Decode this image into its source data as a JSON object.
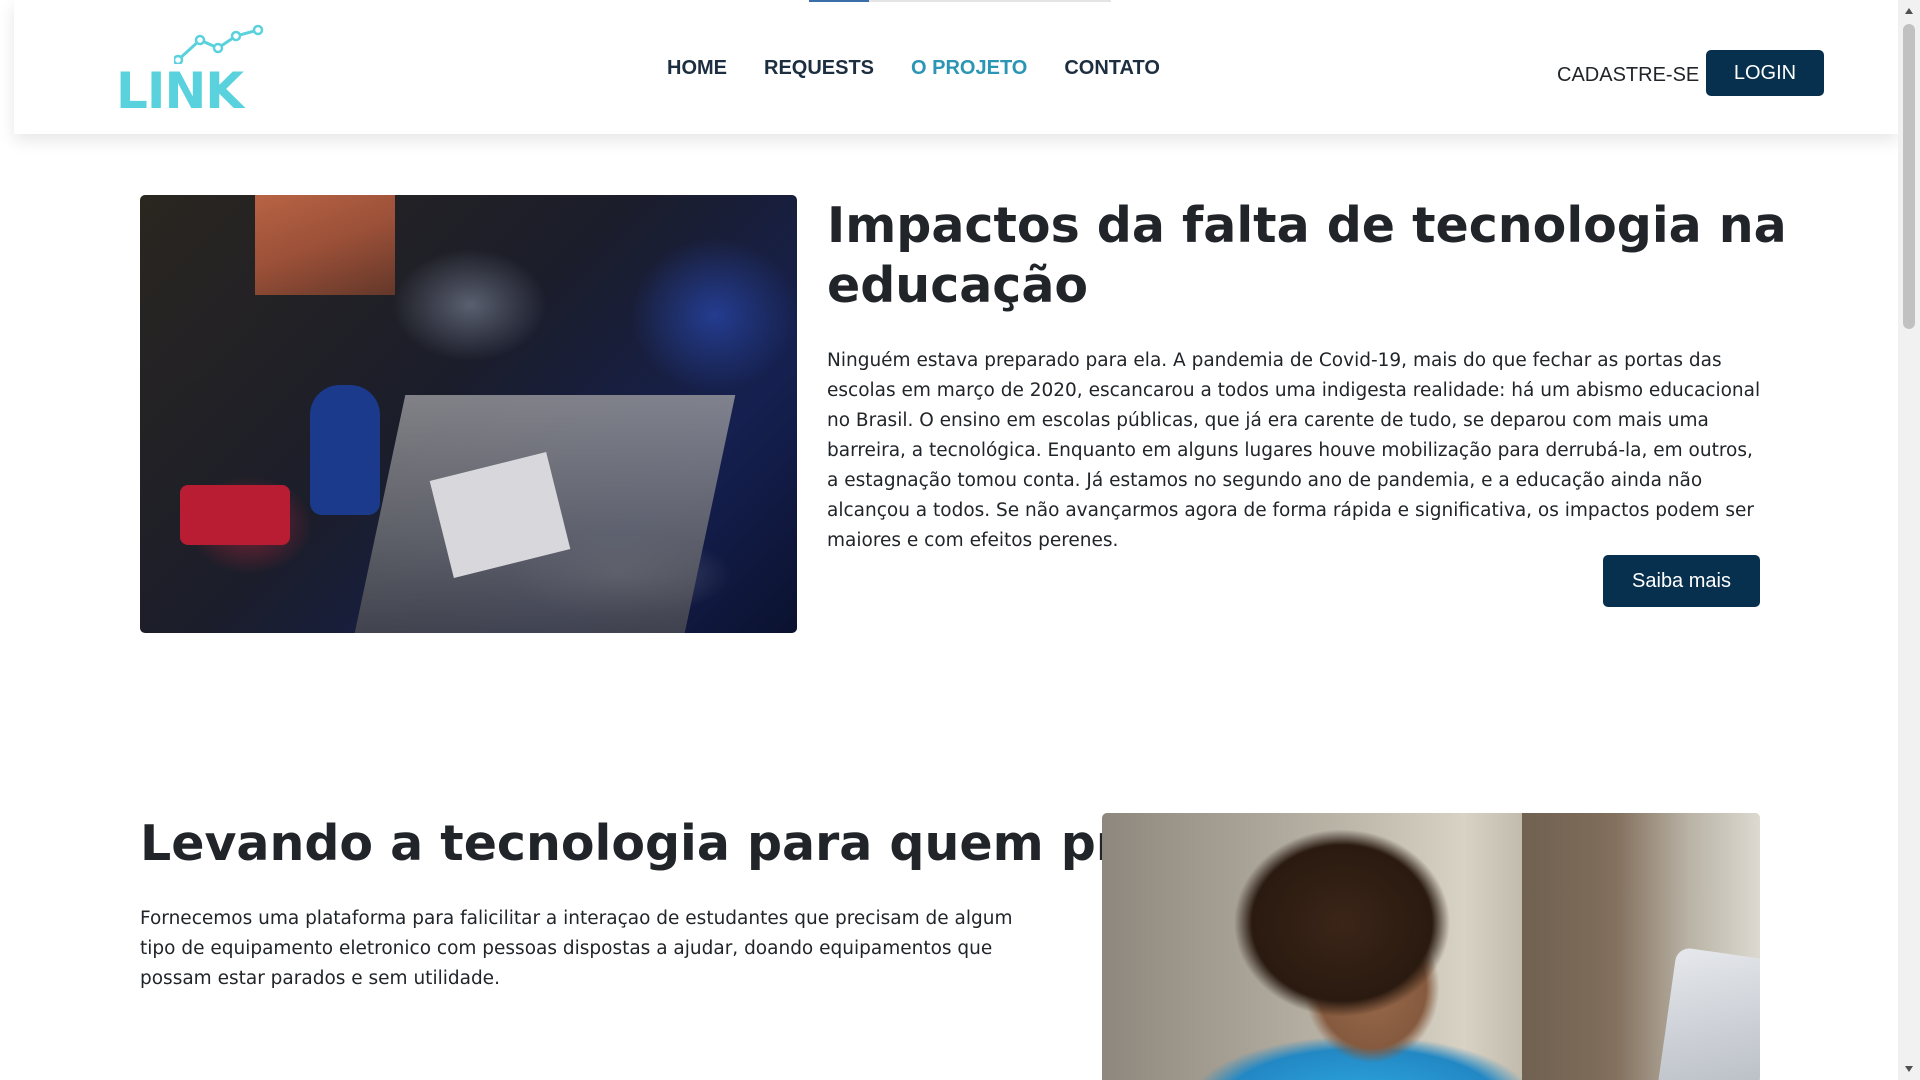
{
  "brand": {
    "logo_text": "LINK",
    "logo_color": "#5ad2de",
    "logo_icon": "line-graph-icon"
  },
  "nav": {
    "items": [
      {
        "label": "HOME",
        "active": false
      },
      {
        "label": "REQUESTS",
        "active": false
      },
      {
        "label": "O PROJETO",
        "active": true
      },
      {
        "label": "CONTATO",
        "active": false
      }
    ],
    "active_color": "#2a95b4",
    "text_color": "#1c2e3f"
  },
  "auth": {
    "signup_label": "CADASTRE-SE",
    "login_label": "LOGIN",
    "button_color": "#06304d"
  },
  "section_impacts": {
    "image_name": "family-studying-at-table-photo",
    "title": "Impactos da falta de tecnologia na educação",
    "body": "Ninguém estava preparado para ela. A pandemia de Covid-19, mais do que fechar as portas das escolas em março de 2020, escancarou a todos uma indigesta realidade: há um abismo educacional no Brasil. O ensino em escolas públicas, que já era carente de tudo, se deparou com mais uma barreira, a tecnológica. Enquanto em alguns lugares houve mobilização para derrubá-la, em outros, a estagnação tomou conta. Já estamos no segundo ano de pandemia, e a educação ainda não alcançou a todos. Se não avançarmos agora de forma rápida e significativa, os impactos podem ser maiores e com efeitos perenes.",
    "cta_label": "Saiba mais"
  },
  "section_mission": {
    "title": "Levando a tecnologia para quem precisa",
    "body": "Fornecemos uma plataforma para falicilitar a interaçao de estudantes que precisam de algum tipo de equipamento eletronico com pessoas dispostas a ajudar, doando equipamentos que possam estar parados e sem utilidade.",
    "image_name": "young-man-with-laptop-photo"
  },
  "scrollbar": {
    "up_icon": "scroll-up-arrow-icon",
    "down_icon": "scroll-down-arrow-icon"
  }
}
